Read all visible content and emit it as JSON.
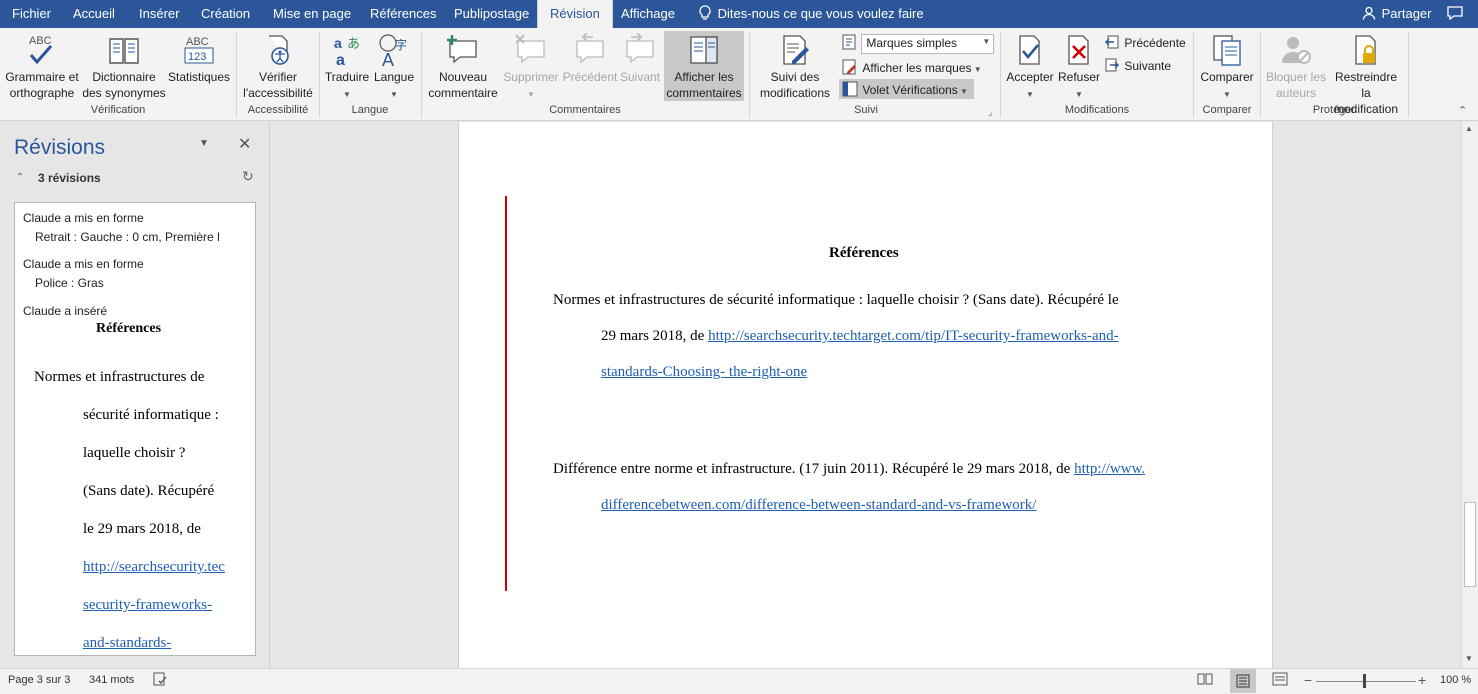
{
  "tabs": [
    "Fichier",
    "Accueil",
    "Insérer",
    "Création",
    "Mise en page",
    "Références",
    "Publipostage",
    "Révision",
    "Affichage"
  ],
  "tell_me": "Dites-nous ce que vous voulez faire",
  "share": "Partager",
  "ribbon": {
    "grammar": "Grammaire et orthographe",
    "thesaurus": "Dictionnaire des synonymes",
    "stats": "Statistiques",
    "group_verification": "Vérification",
    "check_access": "Vérifier l'accessibilité",
    "group_access": "Accessibilité",
    "translate": "Traduire",
    "language": "Langue",
    "group_language": "Langue",
    "new_comment": "Nouveau commentaire",
    "delete": "Supprimer",
    "previous": "Précédent",
    "next": "Suivant",
    "show_comments": "Afficher les commentaires",
    "group_comments": "Commentaires",
    "track_changes": "Suivi des modifications",
    "markup_select": "Marques simples",
    "show_markup": "Afficher les marques",
    "review_pane": "Volet Vérifications",
    "group_tracking": "Suivi",
    "accept": "Accepter",
    "reject": "Refuser",
    "prev_change": "Précédente",
    "next_change": "Suivante",
    "group_changes": "Modifications",
    "compare": "Comparer",
    "group_compare": "Comparer",
    "block_authors": "Bloquer les auteurs",
    "restrict": "Restreindre la modification",
    "group_protect": "Protéger"
  },
  "pane": {
    "title": "Révisions",
    "count": "3 révisions",
    "rev1_head": "Claude a mis en forme",
    "rev1_detail": "Retrait : Gauche : 0 cm, Première l",
    "rev2_head": "Claude a mis en forme",
    "rev2_detail": "Police : Gras",
    "rev3_head": "Claude a inséré",
    "ins_title": "Références",
    "ins_lines": [
      "Normes et infrastructures de",
      "sécurité informatique :",
      "laquelle choisir ?",
      "(Sans date). Récupéré",
      "le 29 mars 2018, de"
    ],
    "ins_links": [
      "http://searchsecurity.tec",
      "security-frameworks-",
      "and-standards-"
    ]
  },
  "doc": {
    "heading": "Références",
    "ref1_line1": "Normes et infrastructures de sécurité informatique : laquelle choisir ? (Sans date). Récupéré le",
    "ref1_line2_prefix": "29 mars 2018, de ",
    "ref1_link1": "http://searchsecurity.techtarget.com/tip/IT-security-frameworks-and-",
    "ref1_link2": "standards-Choosing- the-right-one",
    "ref2_line1_prefix": "Différence entre norme et infrastructure. (17 juin 2011). Récupéré le 29 mars 2018, de ",
    "ref2_link1": "http://www.",
    "ref2_link2": "differencebetween.com/difference-between-standard-and-vs-framework/"
  },
  "status": {
    "page": "Page 3 sur 3",
    "words": "341 mots",
    "zoom": "100 %"
  },
  "colors": {
    "brand": "#2b579a",
    "change_bar": "#d00000",
    "link": "#1f5fb4"
  }
}
